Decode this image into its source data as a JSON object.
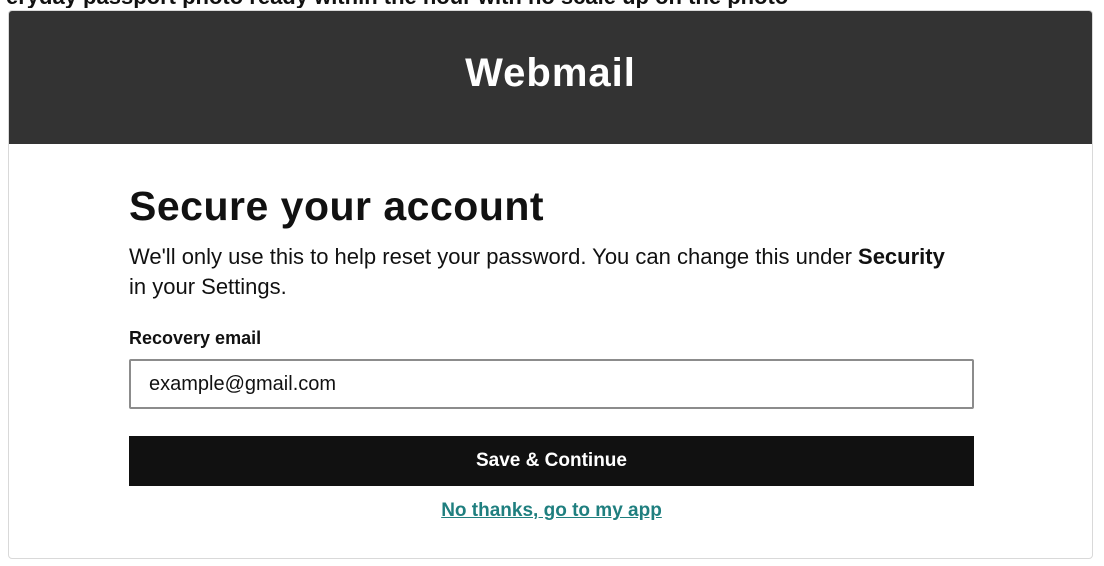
{
  "top_caption": "eryday passport photo ready within the hour with no scale up on the photo",
  "header": {
    "title": "Webmail"
  },
  "main": {
    "headline": "Secure your account",
    "description_part1": "We'll only use this to help reset your password. You can change this under ",
    "description_bold": "Security",
    "description_part2": " in your Settings.",
    "recovery_label": "Recovery email",
    "recovery_placeholder": "example@gmail.com",
    "save_label": "Save & Continue",
    "skip_label": "No thanks, go to my app"
  },
  "colors": {
    "header_bg": "#333333",
    "button_bg": "#111111",
    "link": "#1f7f7f"
  }
}
